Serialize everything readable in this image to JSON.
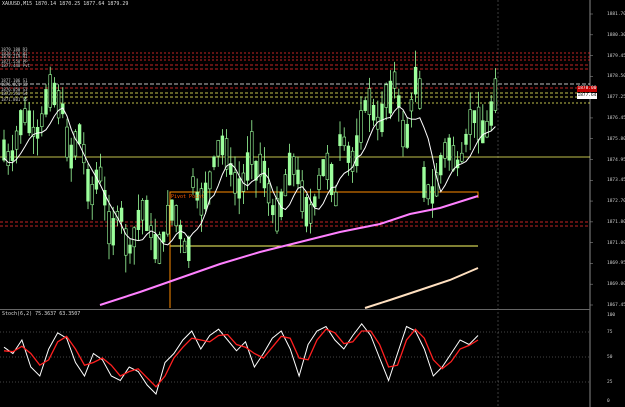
{
  "window": {
    "header": "XAUUSD,M15  1870.14 1870.25 1877.64 1879.29",
    "oscillator_header": "Stoch(6,2) 75.3637 63.3507"
  },
  "price_axis": [
    "1881.70",
    "1880.30",
    "1879.45",
    "1878.50",
    "1877.25",
    "1876.45",
    "1875.80",
    "1874.95",
    "1873.45",
    "1872.70",
    "1871.80",
    "1871.00",
    "1869.95",
    "1869.00",
    "1867.45"
  ],
  "price_badges": [
    "1878.00",
    "1877.64"
  ],
  "osc_axis": [
    "100",
    "75",
    "50",
    "25",
    "0"
  ],
  "level_labels": [
    "1879.188 R3",
    "1878.532 R2",
    "1878.219 R1",
    "1877.558 PP",
    "1877.448 Pvt",
    "1877.106 S1",
    "1876.821 S2",
    "1876.050 S3",
    "1872.550 S4",
    "1871.801 S5"
  ],
  "pivot_label": "Pivot Point",
  "colors": {
    "background": "#000000",
    "bull_candle": "#9cff9c",
    "bear_candle": "#9cff9c",
    "ma_fast": "#ffffff",
    "ma_slow": "#ff80ff",
    "ma_long": "#ffe0c0",
    "pivot_box": "#ff8c00",
    "support_line": "#ffff66",
    "resist_line": "#ff3030",
    "stoch_main": "#ffffff",
    "stoch_signal": "#ff2020"
  },
  "chart_data": {
    "type": "line",
    "title": "XAUUSD,M15",
    "series": [
      {
        "name": "Stoch(6,2) main",
        "values": [
          62,
          55,
          70,
          40,
          30,
          60,
          78,
          72,
          45,
          30,
          55,
          48,
          30,
          25,
          40,
          35,
          20,
          10,
          45,
          55,
          70,
          80,
          60,
          75,
          82,
          70,
          58,
          68,
          40,
          55,
          72,
          80,
          60,
          30,
          65,
          80,
          85,
          70,
          60,
          75,
          88,
          75,
          50,
          25,
          55,
          85,
          80,
          60,
          30,
          40,
          55,
          70,
          65,
          75
        ]
      },
      {
        "name": "Stoch(6,2) signal",
        "values": [
          58,
          57,
          63,
          55,
          42,
          48,
          68,
          74,
          60,
          42,
          45,
          50,
          42,
          30,
          35,
          38,
          28,
          18,
          30,
          50,
          62,
          72,
          70,
          68,
          75,
          76,
          65,
          62,
          55,
          50,
          62,
          74,
          72,
          50,
          48,
          70,
          82,
          78,
          66,
          68,
          80,
          80,
          65,
          40,
          42,
          70,
          82,
          72,
          48,
          38,
          46,
          60,
          64,
          70
        ]
      }
    ],
    "ylim": [
      0,
      100
    ]
  }
}
